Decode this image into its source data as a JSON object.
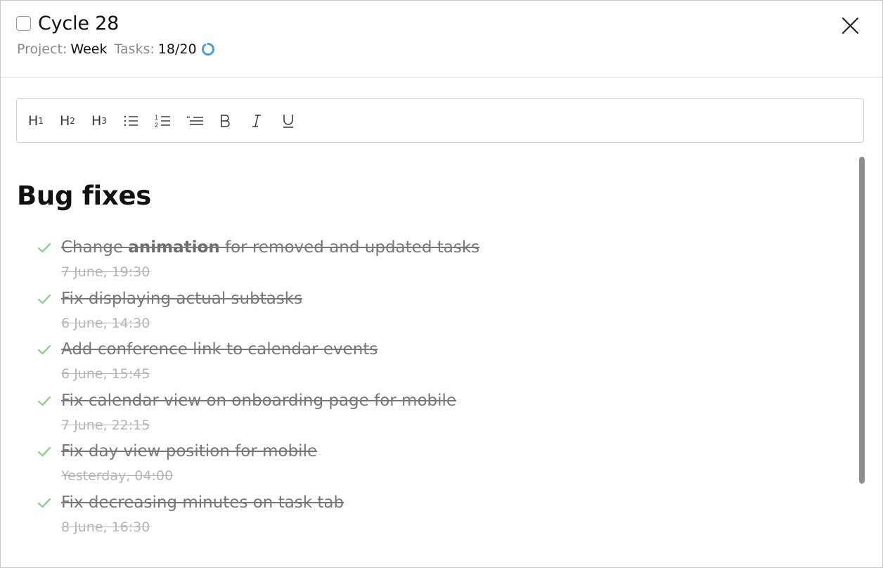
{
  "header": {
    "title": "Cycle 28",
    "project_label": "Project:",
    "project_value": "Week",
    "tasks_label": "Tasks:",
    "tasks_value": "18/20",
    "progress_fraction": 0.9,
    "progress_color": "#4a9fe3",
    "close_icon": "close-icon"
  },
  "toolbar": {
    "buttons": [
      {
        "name": "h1-button",
        "label": "H",
        "sub": "1"
      },
      {
        "name": "h2-button",
        "label": "H",
        "sub": "2"
      },
      {
        "name": "h3-button",
        "label": "H",
        "sub": "3"
      },
      {
        "name": "bullet-list-button",
        "icon": "bullet-list-icon"
      },
      {
        "name": "numbered-list-button",
        "icon": "numbered-list-icon"
      },
      {
        "name": "quote-button",
        "icon": "quote-icon"
      },
      {
        "name": "bold-button",
        "icon": "bold-icon"
      },
      {
        "name": "italic-button",
        "icon": "italic-icon"
      },
      {
        "name": "underline-button",
        "icon": "underline-icon"
      }
    ]
  },
  "section": {
    "title": "Bug fixes",
    "check_color": "#8fd18f",
    "tasks": [
      {
        "pre": "Change ",
        "bold": "animation",
        "post": " for removed and updated tasks",
        "date": "7 June, 19:30"
      },
      {
        "pre": "Fix displaying actual subtasks",
        "bold": "",
        "post": "",
        "date": "6 June, 14:30"
      },
      {
        "pre": "Add conference link to calendar events",
        "bold": "",
        "post": "",
        "date": "6 June, 15:45"
      },
      {
        "pre": "Fix calendar view on onboarding page for mobile",
        "bold": "",
        "post": "",
        "date": "7 June, 22:15"
      },
      {
        "pre": "Fix day view position for mobile",
        "bold": "",
        "post": "",
        "date": "Yesterday, 04:00"
      },
      {
        "pre": "Fix decreasing minutes on task tab",
        "bold": "",
        "post": "",
        "date": "8 June, 16:30"
      }
    ]
  }
}
